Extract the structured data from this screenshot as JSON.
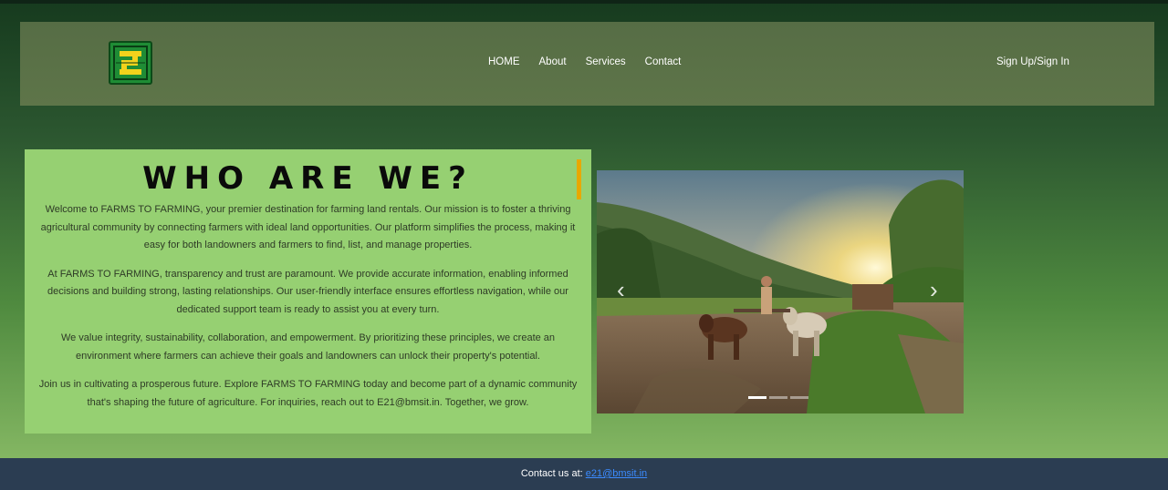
{
  "nav": {
    "links": [
      "HOME",
      "About",
      "Services",
      "Contact"
    ],
    "signin_label": "Sign Up/Sign In"
  },
  "about": {
    "title": "WHO ARE WE?",
    "paragraphs": [
      "Welcome to FARMS TO FARMING, your premier destination for farming land rentals. Our mission is to foster a thriving agricultural community by connecting farmers with ideal land opportunities. Our platform simplifies the process, making it easy for both landowners and farmers to find, list, and manage properties.",
      "At FARMS TO FARMING, transparency and trust are paramount. We provide accurate information, enabling informed decisions and building strong, lasting relationships. Our user-friendly interface ensures effortless navigation, while our dedicated support team is ready to assist you at every turn.",
      "We value integrity, sustainability, collaboration, and empowerment. By prioritizing these principles, we create an environment where farmers can achieve their goals and landowners can unlock their property's potential.",
      "Join us in cultivating a prosperous future. Explore FARMS TO FARMING today and become part of a dynamic community that's shaping the future of agriculture. For inquiries, reach out to E21@bmsit.in. Together, we grow."
    ]
  },
  "carousel": {
    "prev_icon": "chevron-left-icon",
    "next_icon": "chevron-right-icon",
    "prev_glyph": "‹",
    "next_glyph": "›",
    "slide_count": 3,
    "active_slide": 1
  },
  "footer": {
    "prefix": "Contact us at: ",
    "email": "e21@bmsit.in"
  },
  "colors": {
    "navbar": "#5e7549",
    "card": "#96d072",
    "accent": "#e8a800",
    "footer": "#2b3d52",
    "link": "#3b8bff"
  }
}
